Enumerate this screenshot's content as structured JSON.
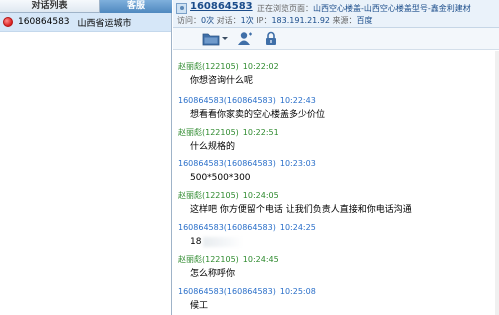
{
  "left_panel": {
    "tabs": [
      {
        "label": "对话列表"
      },
      {
        "label": "客服"
      }
    ],
    "conversation": {
      "visitor_id": "160864583",
      "location": "山西省运城市"
    }
  },
  "header": {
    "visitor_id": "160864583",
    "browsing_label": "正在浏览页面：",
    "browsing_page": "山西空心楼盖-山西空心楼盖型号-鑫金利建材",
    "visits_label": "访问：",
    "visits_value": "0次",
    "dialogs_label": "对话：",
    "dialogs_value": "1次",
    "ip_label": "IP：",
    "ip_value": "183.191.21.92",
    "source_label": "来源：",
    "source_value": "百度"
  },
  "toolbar": {
    "icons": [
      "folder-icon",
      "dropdown-arrow-icon",
      "user-icon",
      "lock-icon"
    ]
  },
  "messages": [
    {
      "sender": "赵丽彪(122105)",
      "time": "10:22:02",
      "text": "你想咨询什么呢",
      "role": "cs"
    },
    {
      "sender": "160864583(160864583)",
      "time": "10:22:43",
      "text": "想看看你家卖的空心楼盖多少价位",
      "role": "visitor"
    },
    {
      "sender": "赵丽彪(122105)",
      "time": "10:22:51",
      "text": "什么规格的",
      "role": "cs"
    },
    {
      "sender": "160864583(160864583)",
      "time": "10:23:03",
      "text": "500*500*300",
      "role": "visitor"
    },
    {
      "sender": "赵丽彪(122105)",
      "time": "10:24:05",
      "text": "这样吧 你方便留个电话  让我们负责人直接和你电话沟通",
      "role": "cs"
    },
    {
      "sender": "160864583(160864583)",
      "time": "10:24:25",
      "text": "18",
      "role": "visitor",
      "redacted": true
    },
    {
      "sender": "赵丽彪(122105)",
      "time": "10:24:45",
      "text": "怎么称呼你",
      "role": "cs"
    },
    {
      "sender": "160864583(160864583)",
      "time": "10:25:08",
      "text": "候工",
      "role": "visitor"
    }
  ],
  "colors": {
    "cs_name": "#2e8a2e",
    "visitor_name": "#2a6fc9",
    "tab_active": "#4f88bf",
    "selected_row": "#d6e7f8"
  }
}
